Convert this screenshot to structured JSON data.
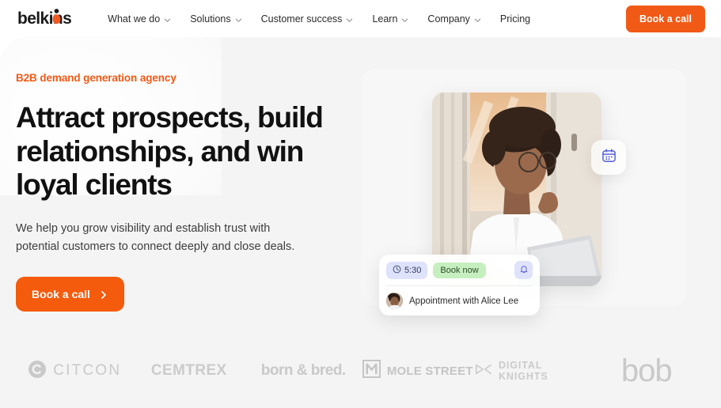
{
  "colors": {
    "brand_orange": "#f15a16",
    "hero_cta_orange": "#f45b0d",
    "hero_bg": "#f4f4f4",
    "headline": "#111111",
    "pill_blue_bg": "#dfe2fb",
    "pill_green_bg": "#c6efbf",
    "logo_gray": "#c9c9c9"
  },
  "header": {
    "logo": {
      "text": "belkins",
      "mark_icon": "person-figure-icon"
    },
    "nav": [
      {
        "label": "What we do",
        "has_dropdown": true
      },
      {
        "label": "Solutions",
        "has_dropdown": true
      },
      {
        "label": "Customer success",
        "has_dropdown": true
      },
      {
        "label": "Learn",
        "has_dropdown": true
      },
      {
        "label": "Company",
        "has_dropdown": true
      },
      {
        "label": "Pricing",
        "has_dropdown": false
      }
    ],
    "cta_label": "Book a call"
  },
  "hero": {
    "eyebrow": "B2B demand generation agency",
    "headline": "Attract prospects, build relationships, and win loyal clients",
    "subhead": "We help you grow visibility and establish trust with potential customers to connect deeply and close deals.",
    "cta_label": "Book a call",
    "cta_icon": "chevron-right-icon"
  },
  "visual": {
    "photo_alt": "woman-with-glasses-at-laptop-photo",
    "calendar_badge_icon": "calendar-icon",
    "appointment_card": {
      "time": "5:30",
      "time_icon": "clock-icon",
      "book_label": "Book now",
      "bell_icon": "bell-icon",
      "avatar_alt": "alice-lee-avatar",
      "title": "Appointment with Alice Lee"
    }
  },
  "client_logos": [
    {
      "name": "CITCON",
      "mark": "circle-c-icon"
    },
    {
      "name": "CEMTREX",
      "mark": ""
    },
    {
      "name": "born & bred.",
      "mark": ""
    },
    {
      "name": "MOLE STREET",
      "mark": "square-m-icon"
    },
    {
      "name": "DIGITAL KNIGHTS",
      "mark": "dk-arrow-icon"
    },
    {
      "name": "bob",
      "mark": ""
    }
  ]
}
